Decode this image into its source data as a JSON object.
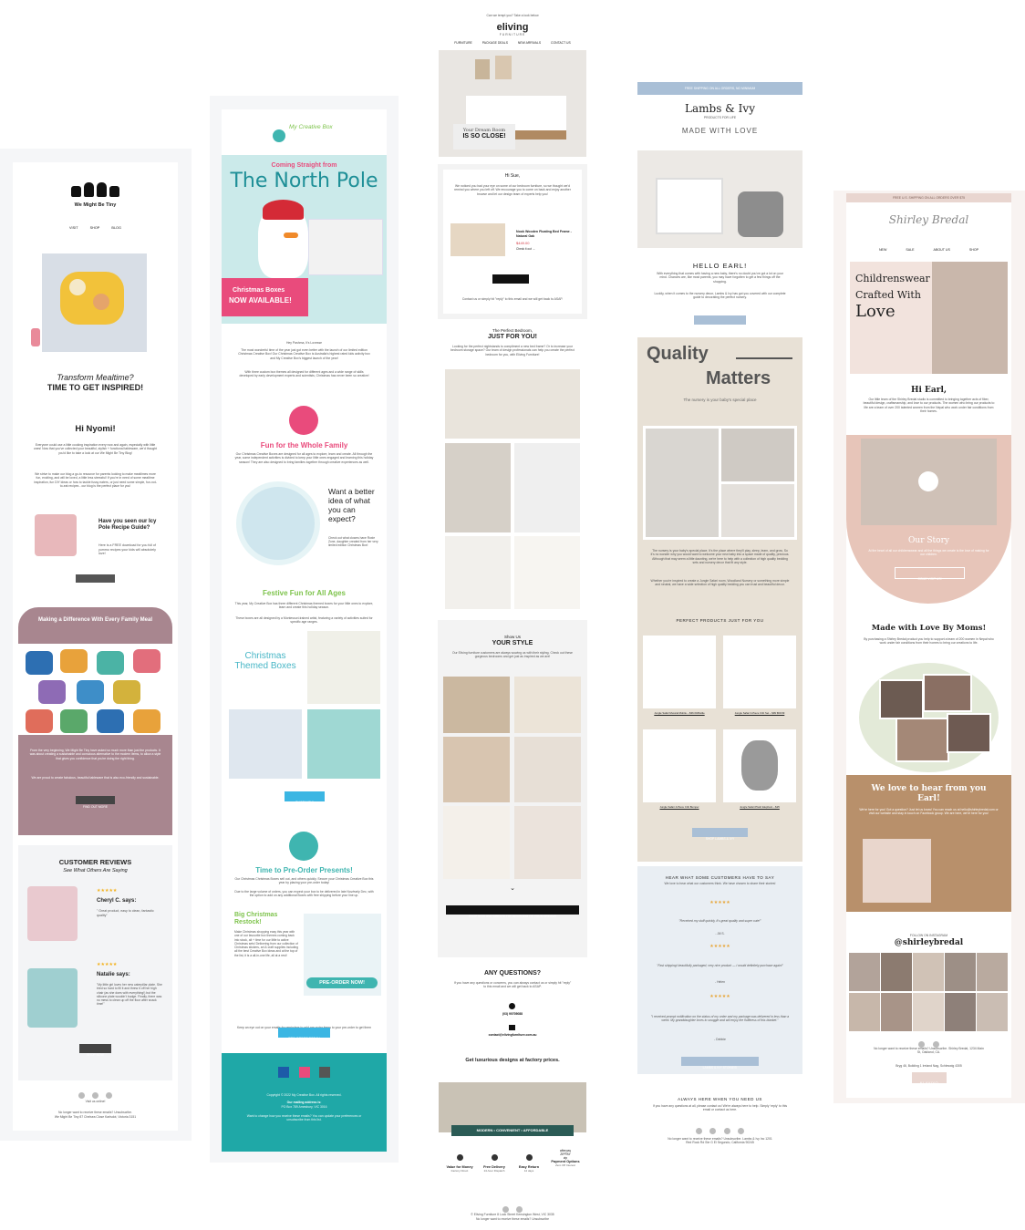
{
  "email1": {
    "brand": "We Might Be Tiny",
    "nav": [
      "VISIT",
      "SHOP",
      "BLOG"
    ],
    "hero_title_line1": "Transform Mealtime?",
    "hero_title_line2": "TIME TO GET INSPIRED!",
    "greeting": "Hi Nyomi!",
    "intro": "Everyone could use a little cooking inspiration every now and again, especially with little ones! Now that you've collected your beautiful, stylish + functional tableware, we'd thought you'd like to take a look at our We Might Be Tiny Blog!",
    "intro2": "We strive to make our blog a go-to resource for parents looking to make mealtimes more fun, exciting, and will be loved, a little less stressful! If you're in need of some mealtime inspiration, fun DIY ideas or how to tackle fussy eaters, or just need some simple, fun-not-to-eat recipes - our blog is the perfect place for you!",
    "recipe_title": "Have you seen our Icy Pole Recipe Guide?",
    "recipe_text": "Here is a FREE download for you full of yummo recipes your kids will absolutely love!",
    "download_btn": "DOWNLOAD NOW",
    "diff_title": "Making a Difference With Every Family Meal",
    "diff_text": "From the very beginning, We Might Be Tiny have asked so much more than just the products. It was about creating a sustainable and conscious alternative to the modern items, to allow a style that gives you confidence that you're doing the right thing.",
    "diff_text2": "We are proud to create fabulous, beautiful tableware that is also eco-friendly and sustainable.",
    "find_out_btn": "FIND OUT MORE",
    "reviews_title": "CUSTOMER REVIEWS",
    "reviews_sub": "See What Others Are Saying",
    "review1_name": "Cheryl C. says:",
    "review1_text": "\" Great product, easy to clean, fantastic quality\"",
    "review2_name": "Natalie says:",
    "review2_text": "\"My little girl loves her new caterpillar plate. She tried so hard to fill it and threw it off her high chair (as she does with everything!) but the silicone plate wouldn't budge. Finally, there was no mess to clean up off the floor after snack time!\"",
    "shop_btn": "SHOP NOW",
    "footer_visit": "Visit us online!",
    "footer_unsub": "No longer want to receive these emails? Unsubscribe.",
    "footer_addr": "We Might Be Tiny 87 Chelsea Close Karlsdot, Victoria 3151"
  },
  "email2": {
    "brand": "My Creative Box",
    "hero_pre": "Coming Straight from",
    "hero_title": "The North Pole",
    "hero_badge_line1": "Christmas Boxes",
    "hero_badge_line2": "NOW AVAILABLE!",
    "greeting": "Hey Pashma, It's Lovesse",
    "intro": "The most wonderful time of the year just got even better with the launch of our limited edition Christmas Creative Box! Our Christmas Creative Box is Australia's highest rated kids activity box and My Creative Box's biggest launch of the year!",
    "intro2": "With three custom box themes all designed for different ages and a wide range of skills developed by early development experts and scientists, Christmas has never been so creative!",
    "s1_title": "Fun for the Whole Family",
    "s1_text": "Our Christmas Creative Boxes are designed for all ages to explore, learn and create. All through the year, some independent activities is divided to keep your little ones engaged and learning this holiday season! They are also designed to bring families together through creative experiences as well.",
    "s1_q": "Want a better idea of what you can expect?",
    "s1_q_text": "Check out what clowns have Roxie Zone, daughter created from her very limited edition Christmas Box!",
    "s2_title": "Festive Fun for All Ages",
    "s2_text": "This year, My Creative Box has three different Christmas themed boxes for your little ones to explore, learn and create this holiday season.",
    "s2_text2": "These boxes are all designed by a Montessori-trained artist, featuring a variety of activities suited for specific age ranges.",
    "s2_boxes_label": "Christmas Themed Boxes",
    "s2_shop_btn": "SHOP NOW",
    "s3_title": "Time to Pre-Order Presents!",
    "s3_text": "Our Christmas Christmas Boxes sell out, and others quickly. Secure your Christmas Creative Box this year by placing your pre-order today!",
    "s3_text2": "Due to the large volume of orders, you can expect your box to be delivered in late Nov/early Dec, with the option to add on any additional Boxes with free shipping before your line up.",
    "s3_restock": "Big Christmas Restock!",
    "s3_restock_text": "Make Christmas shopping easy this year with one of our favourite box themes coming back into stock, alt + time for our little to active Christmas sets! Delivering from our collection of Christmas stickers, art & craft supplies including all the best Creative Box ideas and at the top of the list, it is a all-in-one life, all at a rest!",
    "s3_badge": "PRE-ORDER NOW!",
    "s3_text3": "Keep an eye out on your emails for reminders to add any extra items to your pre-order to get them shipped free with your pre-order!",
    "s3_btn": "PRE-ORDER TODAY",
    "footer_copy": "Copyright © 2022 My Creative Box. All rights reserved.",
    "footer_mail_head": "Our mailing address is:",
    "footer_mail": "PO Box 789 Amesbury, VIC 3016",
    "footer_change": "Want to change how you receive these emails? You can update your preferences or unsubscribe from this list."
  },
  "email3": {
    "pre": "Can we tempt you? Take a look below",
    "brand": "eliving",
    "brand_sub": "FURNITURE",
    "nav": [
      "FURNITURE",
      "PACKAGE DEALS",
      "NEW ARRIVALS",
      "CONTACT US"
    ],
    "hero_line1": "Your Dream Room",
    "hero_line2": "IS SO CLOSE!",
    "greeting": "Hi Sue,",
    "intro": "We noticed you had your eye on some of our bedroom furniture, so we thought we'd remind you where you left off. We encourage you to come on back and enjoy another browse and let our design team of experts help you!",
    "product_name": "Nook Wooden Floating Bed Frame - Natural Oak",
    "product_price": "$449.00",
    "product_cta": "Check it out →",
    "shop_btn": "SHOP NOW",
    "contact": "Contact us or simply hit \"reply\" to this email and we will get back to ASAP.",
    "bed_pre": "The Perfect Bedroom,",
    "bed_title": "JUST FOR YOU!",
    "bed_text": "Looking for the perfect nightstands to compliment a new bed frame? Or to increase your bedroom storage space? Our team of design professionals can help you create the perfect bedroom for you, with Eliving Furniture!",
    "style_pre": "Show Us",
    "style_title": "YOUR STYLE",
    "style_text": "Our Eliving furniture customers are always wowing us with their styling. Check out these gorgeous bedrooms and get just as inspired as we are!",
    "style_btn": "SHOP NOW AND CREATE THE BEDROOM OF YOUR DREAMS",
    "questions_title": "ANY QUESTIONS?",
    "questions_text": "If you have any questions or concerns, you can always contact us or simply hit \"reply\" to this email and we will get back to ASAP.",
    "phone": "(03) 90705088",
    "email": "contact@elivingfurniture.com.au",
    "factory": "Get luxurious designs at factory prices.",
    "banner": "MODERN • CONVENIENT • AFFORDABLE",
    "features": [
      {
        "title": "Value for Money",
        "sub": "Factory Direct"
      },
      {
        "title": "Free Delivery",
        "sub": "24-hour Dispatch"
      },
      {
        "title": "Easy Return",
        "sub": "14 days"
      },
      {
        "title": "Payment Options",
        "sub": "Zero Off Interest"
      }
    ],
    "pay": [
      "afterpay",
      "ZIPPAY",
      "zip"
    ],
    "footer1": "© Eliving Furniture 8 Lock Street Kensington West, VIC 3035",
    "footer2": "No longer want to receive these emails? Unsubscribe"
  },
  "email4": {
    "top_bar": "FREE SHIPPING ON ALL ORDERS, NO MINIMUM",
    "brand": "Lambs & Ivy",
    "brand_sub": "PRODUCTS FOR LIFE",
    "tagline": "MADE WITH LOVE",
    "greeting": "HELLO EARL!",
    "intro": "With everything that comes with having a new baby, there's no doubt you've got a lot on your mind. Chances are, like most parents, you may have forgotten to get a few things off the shopping.",
    "intro2": "Luckily, when it comes to the nursery decor, Lambs & Ivy has got you covered with our complete guide to decorating the perfect nursery.",
    "learn_btn": "LEARN MORE",
    "quality1": "Quality",
    "quality2": "Matters",
    "quality_sub": "The nursery is your baby's special place",
    "body": "The nursery is your baby's special place. It's the place where they'll play, sleep, learn, and grow. So it's no wonder why you would want to welcome your new baby into a space made of quality, precious. Although that may seem a little daunting, we're here to help with a collection of high quality bedding sets and nursery decor that fit any style.",
    "body2": "Whether you're inspired to create a Jungle Safari room, Woodland Nursery or something more simple and neutral, we have a wide selection of high quality bedding you can trust and beautiful decor.",
    "products_title": "PERFECT PRODUCTS JUST FOR YOU",
    "products": [
      "Jungle Safari Musical Mobile – $36.00/Rattle",
      "Jungle Safari 4-Piece Crib Set – $99 $69.99",
      "Jungle Safari 4-Piece Crib Bumper",
      "Jungle Safari Plush Elephant – $25"
    ],
    "shop_btn": "SHOP LAMBS & IVY",
    "reviews_title": "HEAR WHAT SOME CUSTOMERS HAVE TO SAY",
    "reviews_sub": "We love to hear what our customers think. We have chosen to share their stories!",
    "reviews": [
      {
        "quote": "\"Received my stuff quickly, it's great quality and super cute!\"",
        "name": "- Jill S."
      },
      {
        "quote": "\"Fast shipping! beautifully packaged, very nice product — I would definitely purchase again!\"",
        "name": "- Helen"
      },
      {
        "quote": "\"I received prompt notification on the status of my order and my package was delivered in less than a week. My granddaughter loves to snuggle and will enjoy the fluffiness of this blanket.\"",
        "name": "- Debbie"
      }
    ],
    "stories_btn": "LAMBS & IVY STORIES!",
    "help_title": "ALWAYS HERE WHEN YOU NEED US",
    "help_text": "If you have any questions at all, please contact us! We're always here to help. Simply 'reply' to this email or contact us here.",
    "footer": "No longer want to receive these emails? Unsubscribe. Lambs & Ivy Inc 1201 Red Rock Rd Ste G El Segundo, California 90245"
  },
  "email5": {
    "top_bar": "FREE U.S. SHIPPING ON ALL ORDERS OVER $75",
    "brand": "Shirley Bredal",
    "nav": [
      "NEW",
      "SALE",
      "ABOUT US",
      "SHOP"
    ],
    "hero_line1": "Childrenswear",
    "hero_line2": "Crafted With",
    "hero_line3": "Love",
    "greeting": "Hi Earl,",
    "intro": "Our little team of the Shirley Bredal studio is committed to bringing together acts of fiber, beautiful design, craftsmanship, and love to our products. The women who bring our products to life are a team of over 200 talented women from the Nepal who work under fair conditions from their homes.",
    "story_title": "Our Story",
    "story_text": "At the heart of all our childrenswear and all the things we create is the love of making for our children.",
    "story_btn": "COME VISIT US!",
    "made_title": "Made with Love By Moms!",
    "made_text": "By purchasing a Shirley Bredal product you help to support a team of 200 women in Nepal who work under fair conditions from their homes to bring our creations to life.",
    "love_title": "We love to hear from you Earl!",
    "love_text": "We're here for you! Got a question? Just let us know! You can reach us at hello@shirleybredal.com or visit our website and stay in touch on Facebook group. We are here, we're here for you!",
    "follow_pre": "FOLLOW ON INSTAGRAM",
    "follow_handle": "@shirleybredal",
    "footer": "No longer want to receive these emails? Unsubscribe. Shirley Bredal, 1234 Main St, Oakland, CA.",
    "footer_addr": "Bryg 46, Building 1 Ireland Nag, Schleswig 4305",
    "klaviyo": "KLAVIYO"
  },
  "colors": {
    "wmbt_purple": "#a8868f",
    "mcb_pink": "#e94b7c",
    "mcb_teal": "#1fa8a7",
    "eliving_dark": "#222222",
    "lambs_blue": "#a9bfd6",
    "lambs_beige": "#e8e1d6",
    "shirley_pink": "#e9d6d0",
    "shirley_brown": "#b8906b"
  }
}
